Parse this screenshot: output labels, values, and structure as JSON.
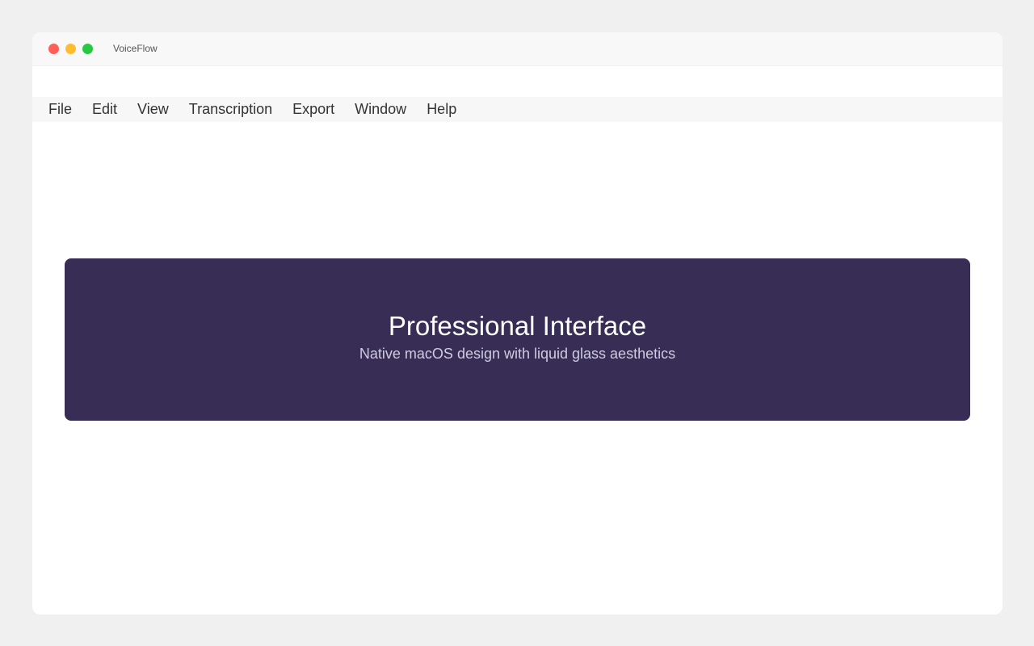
{
  "window": {
    "title": "VoiceFlow"
  },
  "menu": {
    "items": [
      {
        "label": "File"
      },
      {
        "label": "Edit"
      },
      {
        "label": "View"
      },
      {
        "label": "Transcription"
      },
      {
        "label": "Export"
      },
      {
        "label": "Window"
      },
      {
        "label": "Help"
      }
    ]
  },
  "hero": {
    "title": "Professional Interface",
    "subtitle": "Native macOS design with liquid glass aesthetics",
    "background_color": "#372d55"
  },
  "colors": {
    "close": "#ff5f57",
    "minimize": "#ffbd2e",
    "zoom": "#28c940"
  }
}
